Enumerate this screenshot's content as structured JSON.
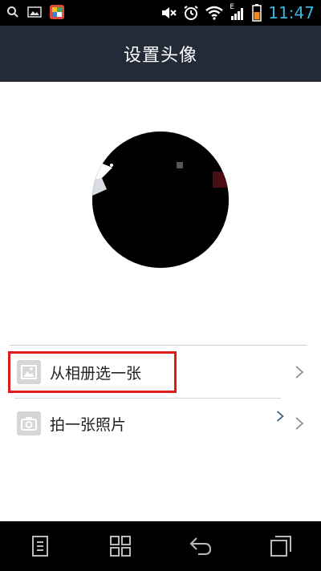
{
  "status_bar": {
    "time": "11:47",
    "icons": [
      "search-icon",
      "gallery-icon",
      "app-icon",
      "mute-icon",
      "alarm-icon",
      "wifi-icon",
      "signal-icon",
      "battery-icon"
    ],
    "signal_label": "E"
  },
  "header": {
    "title": "设置头像"
  },
  "options": [
    {
      "label": "从相册选一张",
      "icon": "image-icon"
    },
    {
      "label": "拍一张照片",
      "icon": "camera-icon"
    }
  ],
  "colors": {
    "appbar": "#232b39",
    "highlight": "#e01b1b",
    "time": "#39b5e6"
  },
  "navbar": {
    "buttons": [
      "menu-icon",
      "apps-grid-icon",
      "back-icon",
      "recent-apps-icon"
    ]
  }
}
